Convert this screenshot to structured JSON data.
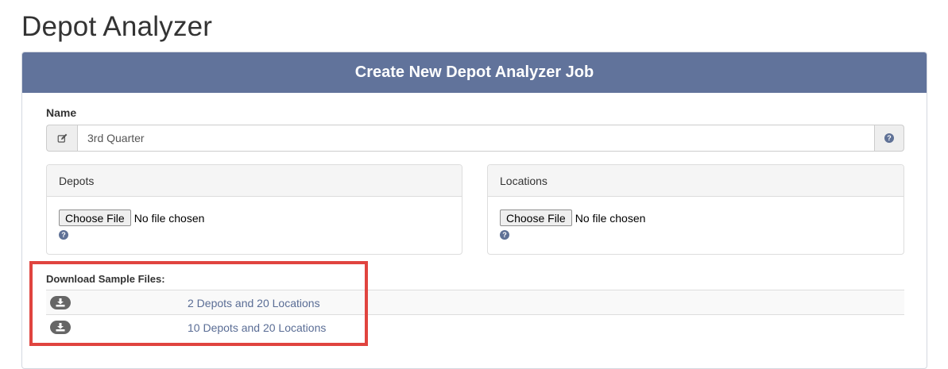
{
  "page": {
    "title": "Depot Analyzer"
  },
  "panel": {
    "title": "Create New Depot Analyzer Job"
  },
  "name_field": {
    "label": "Name",
    "value": "3rd Quarter",
    "left_icon": "edit-icon",
    "right_icon": "question-circle-icon"
  },
  "depots": {
    "title": "Depots",
    "button_label": "Choose File",
    "status": "No file chosen",
    "help_icon": "question-circle-icon"
  },
  "locations": {
    "title": "Locations",
    "button_label": "Choose File",
    "status": "No file chosen",
    "help_icon": "question-circle-icon"
  },
  "downloads": {
    "label": "Download Sample Files:",
    "items": [
      {
        "label": "2 Depots and 20 Locations",
        "icon": "download-icon"
      },
      {
        "label": "10 Depots and 20 Locations",
        "icon": "download-icon"
      }
    ]
  },
  "colors": {
    "header": "#61739b",
    "link": "#5a6d95",
    "highlight": "#e0443f"
  }
}
